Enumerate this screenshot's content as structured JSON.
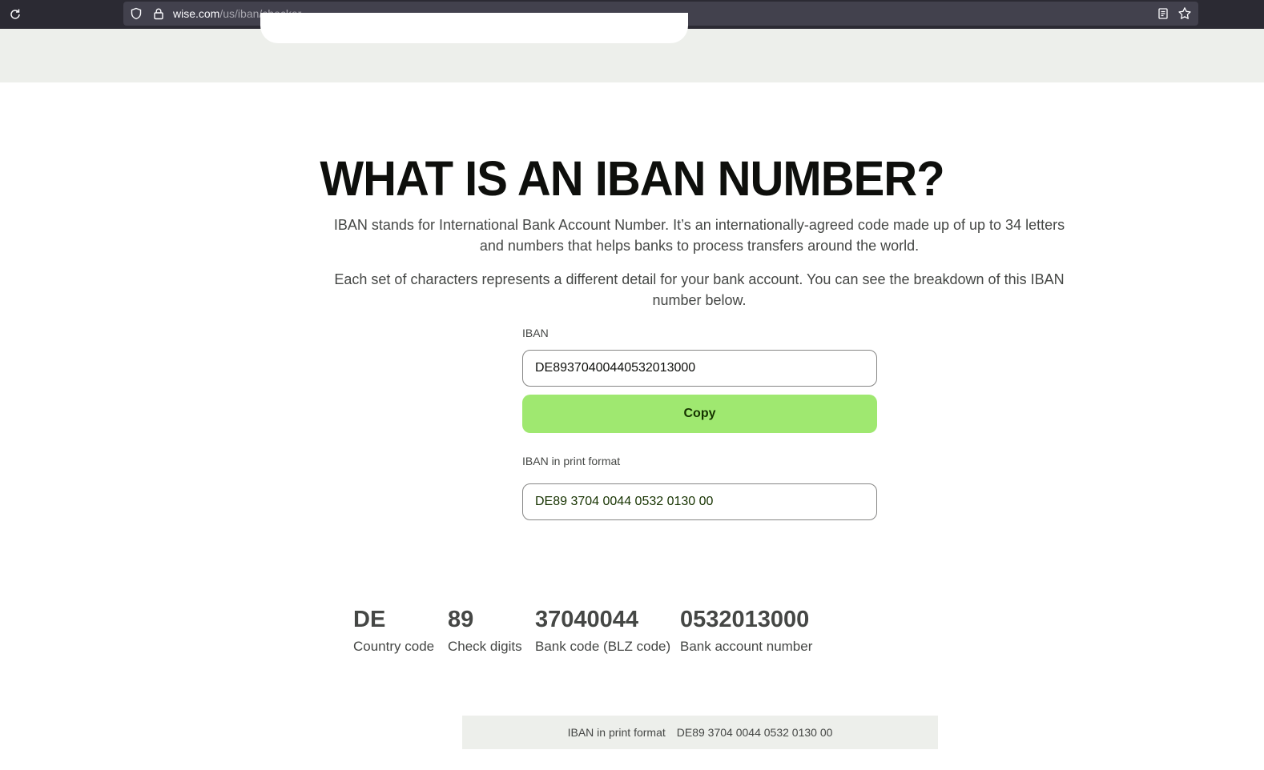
{
  "browser": {
    "url_domain": "wise.com",
    "url_path": "/us/iban/checker",
    "icons": [
      "reload-icon",
      "shield-icon",
      "lock-icon",
      "reader-view-icon",
      "bookmark-star-icon"
    ]
  },
  "main": {
    "heading": "WHAT IS AN IBAN NUMBER?",
    "paragraph1": "IBAN stands for International Bank Account Number. It’s an internationally-agreed code made up of up to 34 letters and numbers that helps banks to process transfers around the world.",
    "paragraph2": "Each set of characters represents a different detail for your bank account. You can see the breakdown of this IBAN number below."
  },
  "iban_field": {
    "label": "IBAN",
    "value": "DE89370400440532013000"
  },
  "copy_button": {
    "label": "Copy"
  },
  "print_field": {
    "label": "IBAN in print format",
    "value": "DE89 3704 0044 0532 0130 00"
  },
  "breakdown": [
    {
      "value": "DE",
      "caption": "Country code"
    },
    {
      "value": "89",
      "caption": "Check digits"
    },
    {
      "value": "37040044",
      "caption": "Bank code (BLZ code)"
    },
    {
      "value": "0532013000",
      "caption": "Bank account number"
    }
  ],
  "bottom_bar": {
    "label": "IBAN in print format",
    "value": "DE89 3704 0044 0532 0130 00"
  },
  "colors": {
    "accent_green": "#9fe870",
    "band_gray": "#edefeb",
    "toolbar": "#2b2a33"
  }
}
